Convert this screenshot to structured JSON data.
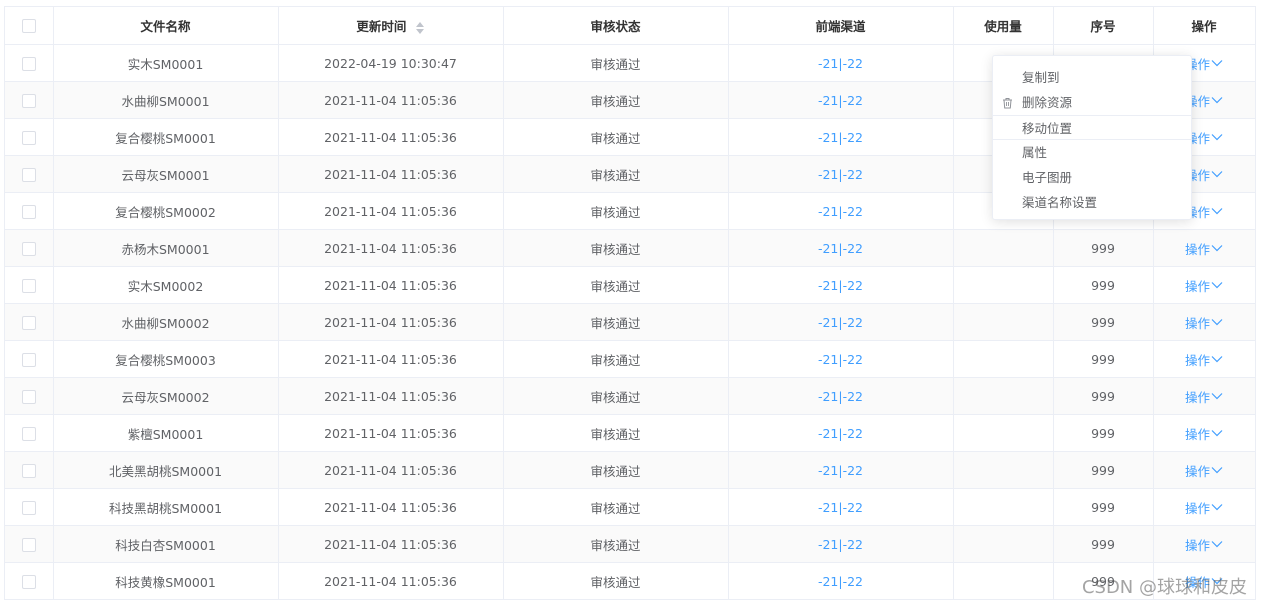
{
  "table": {
    "headers": {
      "name": "文件名称",
      "updated": "更新时间",
      "status": "审核状态",
      "channel": "前端渠道",
      "usage": "使用量",
      "seq": "序号",
      "action": "操作"
    },
    "rows": [
      {
        "name": "实木SM0001",
        "updated": "2022-04-19 10:30:47",
        "status": "审核通过",
        "channel": "-21|-22",
        "usage": "",
        "seq": "",
        "action": "操作"
      },
      {
        "name": "水曲柳SM0001",
        "updated": "2021-11-04 11:05:36",
        "status": "审核通过",
        "channel": "-21|-22",
        "usage": "",
        "seq": "",
        "action": "操作"
      },
      {
        "name": "复合樱桃SM0001",
        "updated": "2021-11-04 11:05:36",
        "status": "审核通过",
        "channel": "-21|-22",
        "usage": "",
        "seq": "",
        "action": "操作"
      },
      {
        "name": "云母灰SM0001",
        "updated": "2021-11-04 11:05:36",
        "status": "审核通过",
        "channel": "-21|-22",
        "usage": "",
        "seq": "",
        "action": "操作"
      },
      {
        "name": "复合樱桃SM0002",
        "updated": "2021-11-04 11:05:36",
        "status": "审核通过",
        "channel": "-21|-22",
        "usage": "",
        "seq": "",
        "action": "操作"
      },
      {
        "name": "赤杨木SM0001",
        "updated": "2021-11-04 11:05:36",
        "status": "审核通过",
        "channel": "-21|-22",
        "usage": "",
        "seq": "999",
        "action": "操作"
      },
      {
        "name": "实木SM0002",
        "updated": "2021-11-04 11:05:36",
        "status": "审核通过",
        "channel": "-21|-22",
        "usage": "",
        "seq": "999",
        "action": "操作"
      },
      {
        "name": "水曲柳SM0002",
        "updated": "2021-11-04 11:05:36",
        "status": "审核通过",
        "channel": "-21|-22",
        "usage": "",
        "seq": "999",
        "action": "操作"
      },
      {
        "name": "复合樱桃SM0003",
        "updated": "2021-11-04 11:05:36",
        "status": "审核通过",
        "channel": "-21|-22",
        "usage": "",
        "seq": "999",
        "action": "操作"
      },
      {
        "name": "云母灰SM0002",
        "updated": "2021-11-04 11:05:36",
        "status": "审核通过",
        "channel": "-21|-22",
        "usage": "",
        "seq": "999",
        "action": "操作"
      },
      {
        "name": "紫檀SM0001",
        "updated": "2021-11-04 11:05:36",
        "status": "审核通过",
        "channel": "-21|-22",
        "usage": "",
        "seq": "999",
        "action": "操作"
      },
      {
        "name": "北美黑胡桃SM0001",
        "updated": "2021-11-04 11:05:36",
        "status": "审核通过",
        "channel": "-21|-22",
        "usage": "",
        "seq": "999",
        "action": "操作"
      },
      {
        "name": "科技黑胡桃SM0001",
        "updated": "2021-11-04 11:05:36",
        "status": "审核通过",
        "channel": "-21|-22",
        "usage": "",
        "seq": "999",
        "action": "操作"
      },
      {
        "name": "科技白杏SM0001",
        "updated": "2021-11-04 11:05:36",
        "status": "审核通过",
        "channel": "-21|-22",
        "usage": "",
        "seq": "999",
        "action": "操作"
      },
      {
        "name": "科技黄橡SM0001",
        "updated": "2021-11-04 11:05:36",
        "status": "审核通过",
        "channel": "-21|-22",
        "usage": "",
        "seq": "999",
        "action": "操作"
      }
    ]
  },
  "dropdown": {
    "items": [
      {
        "label": "复制到",
        "icon": ""
      },
      {
        "label": "删除资源",
        "icon": "trash-icon"
      },
      {
        "label": "移动位置",
        "icon": ""
      },
      {
        "label": "属性",
        "icon": ""
      },
      {
        "label": "电子图册",
        "icon": ""
      },
      {
        "label": "渠道名称设置",
        "icon": ""
      }
    ]
  },
  "watermark": "CSDN @球球和皮皮",
  "colors": {
    "link": "#409eff",
    "border": "#ebeef5",
    "stripe": "#fafafa",
    "text": "#606266",
    "header": "#333333"
  }
}
